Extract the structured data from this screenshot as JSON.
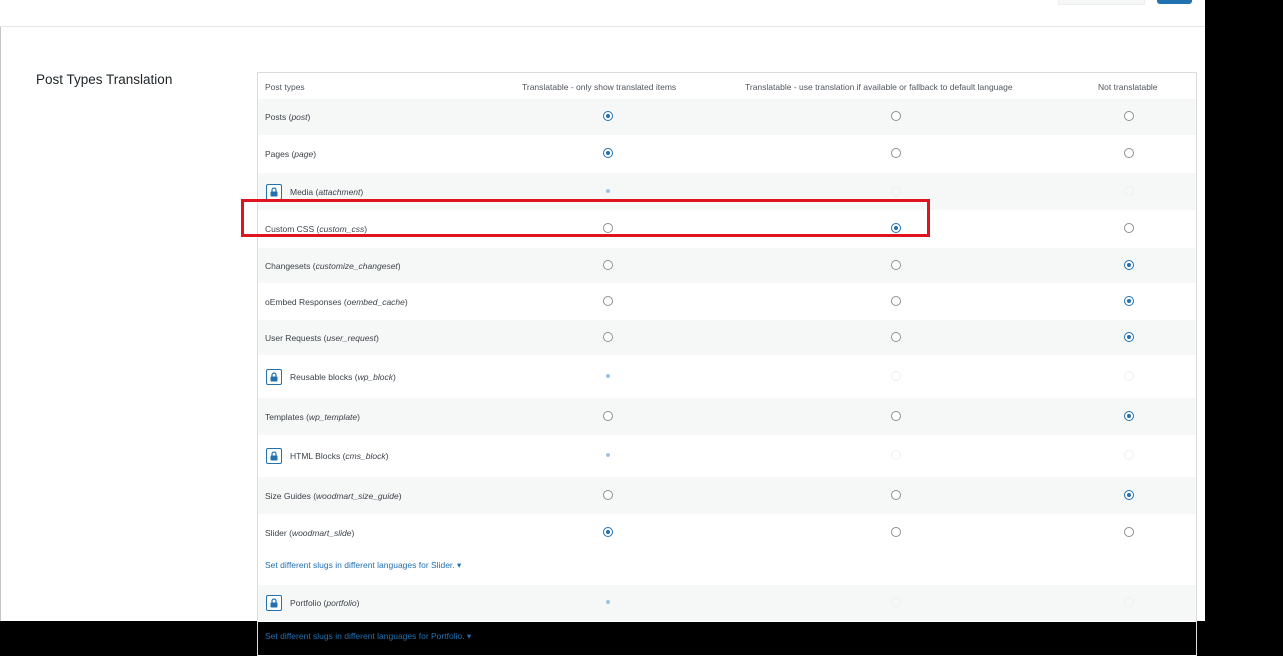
{
  "section_title": "Post Types Translation",
  "columns": {
    "post_types": "Post types",
    "translatable_only": "Translatable - only show translated items",
    "translatable_fallback": "Translatable - use translation if available or fallback to default language",
    "not_translatable": "Not translatable"
  },
  "rows": [
    {
      "name": "Posts",
      "slug": "post",
      "locked": false,
      "selected": "translatable_only"
    },
    {
      "name": "Pages",
      "slug": "page",
      "locked": false,
      "selected": "translatable_only"
    },
    {
      "name": "Media",
      "slug": "attachment",
      "locked": true,
      "selected": "translatable_only"
    },
    {
      "name": "Custom CSS",
      "slug": "custom_css",
      "locked": false,
      "selected": "translatable_fallback"
    },
    {
      "name": "Changesets",
      "slug": "customize_changeset",
      "locked": false,
      "selected": "not_translatable"
    },
    {
      "name": "oEmbed Responses",
      "slug": "oembed_cache",
      "locked": false,
      "selected": "not_translatable"
    },
    {
      "name": "User Requests",
      "slug": "user_request",
      "locked": false,
      "selected": "not_translatable"
    },
    {
      "name": "Reusable blocks",
      "slug": "wp_block",
      "locked": true,
      "selected": "translatable_only"
    },
    {
      "name": "Templates",
      "slug": "wp_template",
      "locked": false,
      "selected": "not_translatable"
    },
    {
      "name": "HTML Blocks",
      "slug": "cms_block",
      "locked": true,
      "selected": "translatable_only"
    },
    {
      "name": "Size Guides",
      "slug": "woodmart_size_guide",
      "locked": false,
      "selected": "not_translatable"
    },
    {
      "name": "Slider",
      "slug": "woodmart_slide",
      "locked": false,
      "selected": "translatable_only"
    },
    {
      "name": "Portfolio",
      "slug": "portfolio",
      "locked": true,
      "selected": "translatable_only"
    }
  ],
  "slug_links": {
    "slider": "Set different slugs in different languages for Slider. ▾",
    "portfolio": "Set different slugs in different languages for Portfolio. ▾"
  },
  "colors": {
    "accent": "#2271b1",
    "highlight": "#e0141e"
  }
}
